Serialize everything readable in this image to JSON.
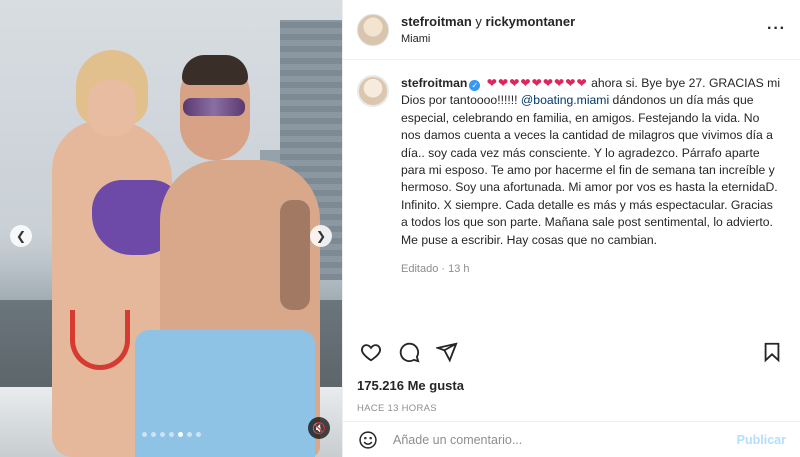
{
  "post": {
    "header": {
      "account_user": "stefroitman",
      "connector": "y",
      "collab_user": "rickymontaner",
      "location": "Miami",
      "more_icon": "ellipsis-icon"
    },
    "caption": {
      "username": "stefroitman",
      "hearts": "❤❤❤❤❤❤❤❤❤",
      "text_before_mention": "ahora si. Bye bye 27. GRACIAS mi Dios por tantoooo!!!!!!",
      "mention": "@boating.miami",
      "text_after_mention": " dándonos un día más que especial, celebrando en familia, en amigos. Festejando la vida. No nos damos cuenta a veces la cantidad de milagros que vivimos día a día.. soy cada vez más consciente. Y lo agradezco. Párrafo aparte para mi esposo. Te amo por hacerme el fin de semana tan increíble y hermoso. Soy una afortunada. Mi amor por vos es hasta la eternidaD. Infinito. X siempre. Cada detalle es más y más espectacular. Gracias a todos los que son parte. Mañana sale post sentimental, lo advierto. Me puse a escribir. Hay cosas que no cambian.",
      "edited": "Editado · 13 h"
    },
    "likes": "175.216 Me gusta",
    "timestamp": "HACE 13 HORAS",
    "comment": {
      "placeholder": "Añade un comentario...",
      "publish_label": "Publicar"
    },
    "media": {
      "slide_count": 7,
      "active_slide": 5
    }
  },
  "icons": {
    "like": "heart-icon",
    "comment": "comment-icon",
    "share": "send-icon",
    "save": "bookmark-icon",
    "emoji": "emoji-icon",
    "mute": "mute-icon",
    "prev": "chevron-left-icon",
    "next": "chevron-right-icon"
  },
  "colors": {
    "verified": "#3897f0",
    "mention": "#00376b",
    "hearts": "#e0245e",
    "publish": "#b2dffc"
  }
}
